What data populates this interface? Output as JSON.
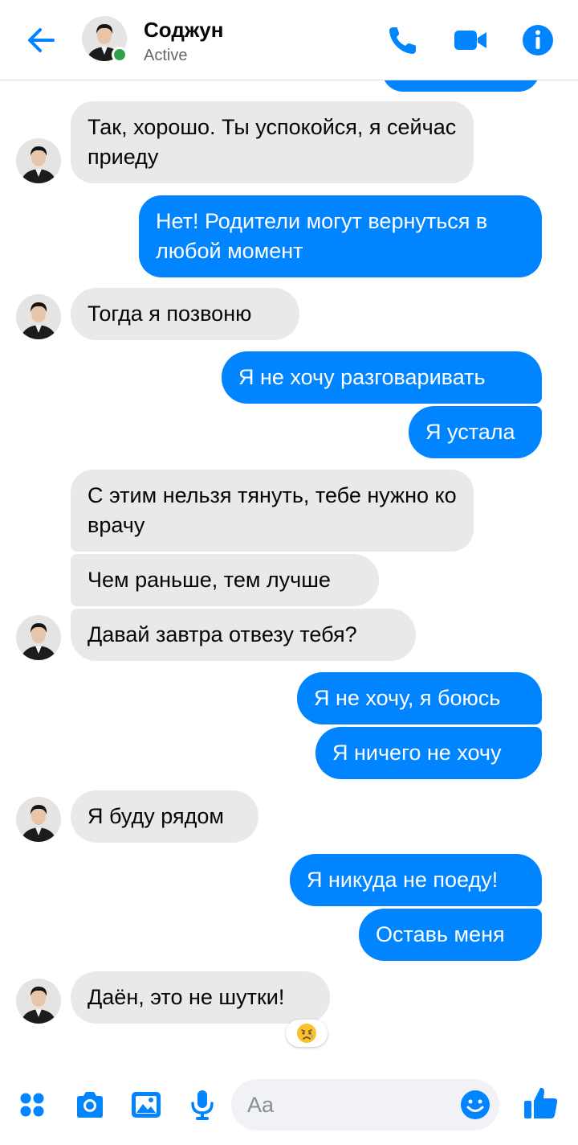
{
  "header": {
    "contact_name": "Соджун",
    "status": "Active"
  },
  "messages": [
    {
      "side": "in",
      "text": "Так, хорошо. Ты успокойся, я сейчас приеду"
    },
    {
      "side": "out",
      "text": "Нет! Родители могут вернуться в любой момент"
    },
    {
      "side": "in",
      "text": "Тогда я позвоню"
    },
    {
      "side": "out",
      "text": "Я не хочу разговаривать"
    },
    {
      "side": "out",
      "text": "Я устала"
    },
    {
      "side": "in",
      "text": "С этим нельзя тянуть, тебе нужно ко врачу"
    },
    {
      "side": "in",
      "text": "Чем раньше, тем лучше"
    },
    {
      "side": "in",
      "text": "Давай завтра отвезу тебя?"
    },
    {
      "side": "out",
      "text": "Я не хочу, я боюсь"
    },
    {
      "side": "out",
      "text": "Я ничего не хочу"
    },
    {
      "side": "in",
      "text": "Я буду рядом"
    },
    {
      "side": "out",
      "text": "Я никуда не поеду!"
    },
    {
      "side": "out",
      "text": "Оставь меня"
    },
    {
      "side": "in",
      "text": "Даён, это не шутки!"
    }
  ],
  "reaction": {
    "emoji": "😥",
    "icon": "sad-relieved-face"
  },
  "composer": {
    "placeholder": "Aa"
  },
  "colors": {
    "accent": "#0084ff",
    "incoming_bubble": "#e9e9eb",
    "online": "#31a24c"
  }
}
